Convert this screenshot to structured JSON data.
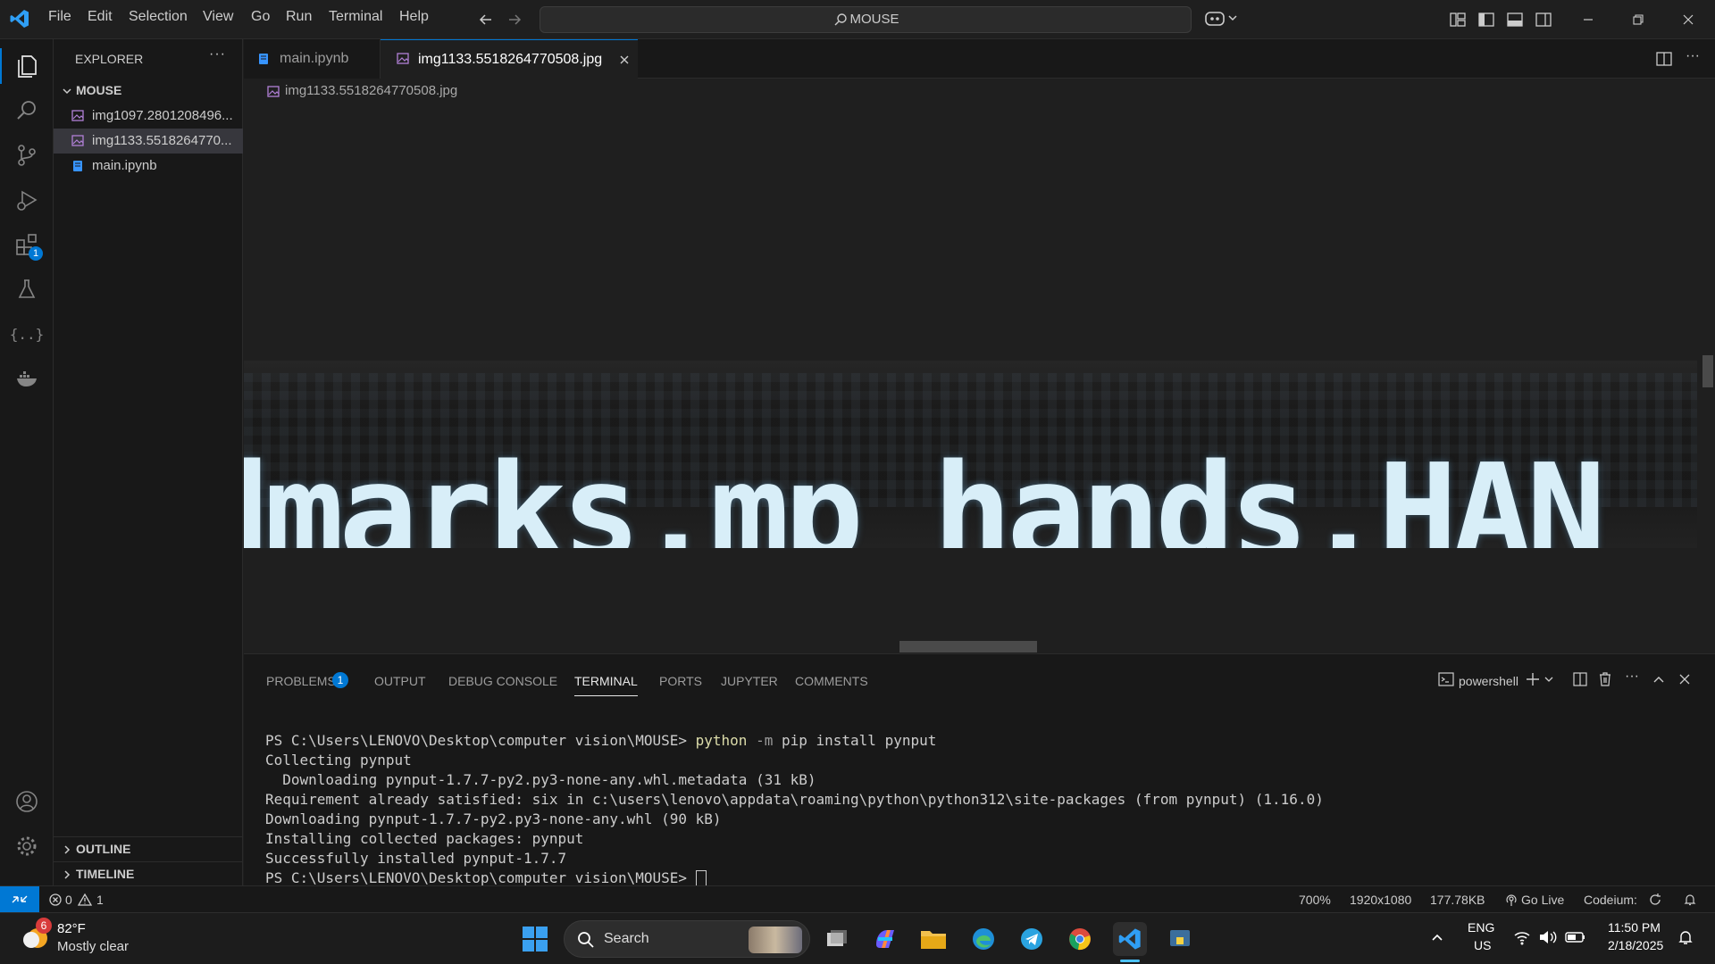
{
  "menu": [
    "File",
    "Edit",
    "Selection",
    "View",
    "Go",
    "Run",
    "Terminal",
    "Help"
  ],
  "command_center": {
    "label": "MOUSE"
  },
  "sidebar": {
    "title": "EXPLORER",
    "folder": "MOUSE",
    "files": [
      {
        "label": "img1097.2801208496..."
      },
      {
        "label": "img1133.5518264770..."
      },
      {
        "label": "main.ipynb"
      }
    ],
    "sections": [
      "OUTLINE",
      "TIMELINE"
    ]
  },
  "activity_badges": {
    "extensions": "1"
  },
  "tabs": [
    {
      "label": "main.ipynb"
    },
    {
      "label": "img1133.5518264770508.jpg"
    }
  ],
  "breadcrumb": "img1133.5518264770508.jpg",
  "image_text": "dmarks,mp_hands.HAN",
  "panel": {
    "tabs": [
      "PROBLEMS",
      "OUTPUT",
      "DEBUG CONSOLE",
      "TERMINAL",
      "PORTS",
      "JUPYTER",
      "COMMENTS"
    ],
    "problems_badge": "1",
    "shell": "powershell",
    "terminal_lines": {
      "l1_prompt": "PS C:\\Users\\LENOVO\\Desktop\\computer vision\\MOUSE> ",
      "l1_cmd": "python",
      "l1_flag": " -m ",
      "l1_rest": "pip install pynput",
      "l2": "Collecting pynput",
      "l3": "  Downloading pynput-1.7.7-py2.py3-none-any.whl.metadata (31 kB)",
      "l4": "Requirement already satisfied: six in c:\\users\\lenovo\\appdata\\roaming\\python\\python312\\site-packages (from pynput) (1.16.0)",
      "l5": "Downloading pynput-1.7.7-py2.py3-none-any.whl (90 kB)",
      "l6": "Installing collected packages: pynput",
      "l7": "Successfully installed pynput-1.7.7",
      "l8": "PS C:\\Users\\LENOVO\\Desktop\\computer vision\\MOUSE> "
    }
  },
  "statusbar": {
    "errors": "0",
    "warnings": "1",
    "zoom": "700%",
    "dimensions": "1920x1080",
    "filesize": "177.78KB",
    "golive": "Go Live",
    "codeium": "Codeium:"
  },
  "taskbar": {
    "weather_temp": "82°F",
    "weather_desc": "Mostly clear",
    "weather_badge": "6",
    "search": "Search",
    "lang1": "ENG",
    "lang2": "US",
    "time": "11:50 PM",
    "date": "2/18/2025"
  },
  "colors": {
    "accent": "#0078d4",
    "terminal_yellow": "#dcdcaa"
  }
}
